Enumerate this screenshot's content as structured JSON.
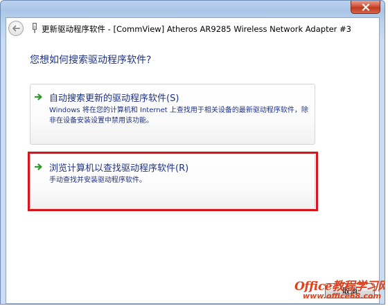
{
  "window": {
    "title": "更新驱动程序软件 - [CommView] Atheros AR9285 Wireless Network Adapter #3"
  },
  "question": "您想如何搜索驱动程序软件?",
  "options": [
    {
      "title": "自动搜索更新的驱动程序软件(S)",
      "description": "Windows 将在您的计算机和 Internet 上查找用于相关设备的最新驱动程序软件，除非在设备安装设置中禁用该功能。"
    },
    {
      "title": "浏览计算机以查找驱动程序软件(R)",
      "description": "手动查找并安装驱动程序软件。"
    }
  ],
  "buttons": {
    "cancel": "取消"
  },
  "watermark": {
    "line1": "Office教程学习网",
    "line2": "www.office68.com"
  },
  "icons": {
    "close": "close-icon",
    "back": "back-arrow-icon",
    "device": "device-icon",
    "option_arrow": "green-arrow-icon"
  },
  "colors": {
    "link_blue": "#1e3287",
    "highlight_red": "#d8141c",
    "close_red": "#c13a21",
    "arrow_green": "#2e9a2e",
    "watermark": "#e0411c"
  }
}
